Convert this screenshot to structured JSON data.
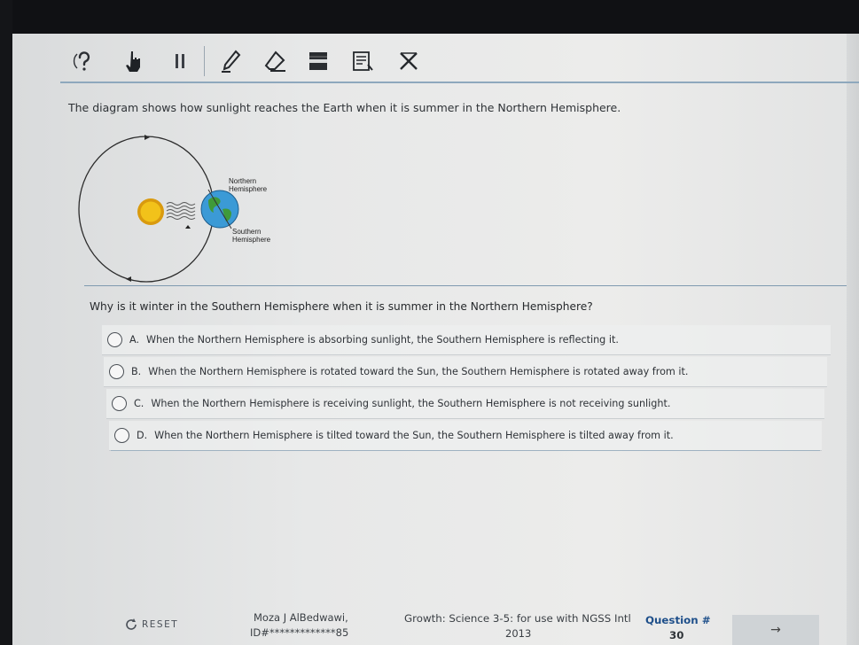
{
  "toolbar": {
    "tools": [
      {
        "icon": "help-question-icon"
      },
      {
        "icon": "pointer-hand-icon"
      },
      {
        "icon": "pause-icon"
      },
      {
        "icon": "pencil-icon"
      },
      {
        "icon": "eraser-icon"
      },
      {
        "icon": "line-reader-icon"
      },
      {
        "icon": "notepad-icon"
      },
      {
        "icon": "answer-eliminator-icon"
      }
    ]
  },
  "prompt": "The diagram shows how sunlight reaches the Earth when it is summer in the Northern Hemisphere.",
  "diagram": {
    "north_label_line1": "Northern",
    "north_label_line2": "Hemisphere",
    "south_label_line1": "Southern",
    "south_label_line2": "Hemisphere",
    "colors": {
      "sun": "#f2c21a",
      "sun_ring": "#d99a0e",
      "earth_ocean": "#3b9ad6",
      "earth_land": "#3f9a3a",
      "orbit": "#2b2b2b"
    }
  },
  "question": "Why is it winter in the Southern Hemisphere when it is summer in the Northern Hemisphere?",
  "choices": [
    {
      "letter": "A.",
      "text": "When the Northern Hemisphere is absorbing sunlight, the Southern Hemisphere is reflecting it."
    },
    {
      "letter": "B.",
      "text": "When the Northern Hemisphere is rotated toward the Sun, the Southern Hemisphere is rotated away from it."
    },
    {
      "letter": "C.",
      "text": "When the Northern Hemisphere is receiving sunlight, the Southern Hemisphere is not receiving sunlight."
    },
    {
      "letter": "D.",
      "text": "When the Northern Hemisphere is tilted toward the Sun, the Southern Hemisphere is tilted away from it."
    }
  ],
  "footer": {
    "reset_label": "RESET",
    "student_name": "Moza J AlBedwawi,",
    "student_id": "ID#*************85",
    "test_name": "Growth: Science 3-5: for use with NGSS Intl",
    "test_year": "2013",
    "question_label": "Question #",
    "question_number": "30",
    "next_glyph": "→"
  }
}
